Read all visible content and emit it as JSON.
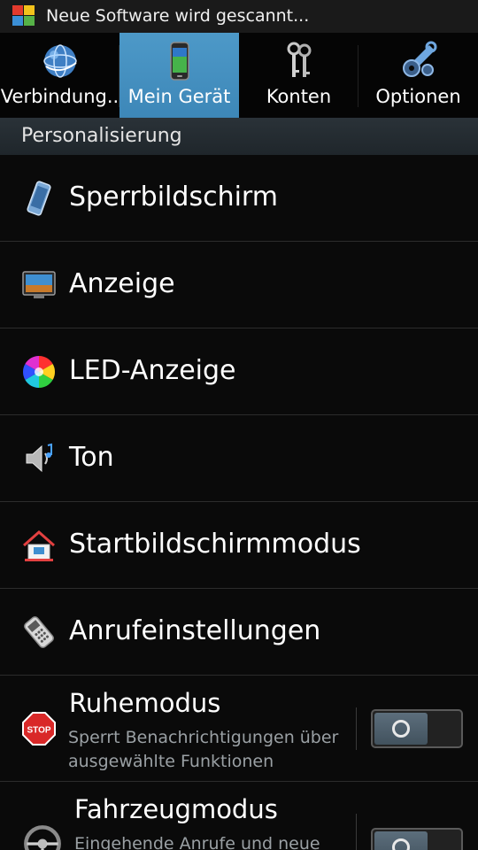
{
  "status_bar": {
    "notification_text": "Neue Software wird gescannt...",
    "icon": "shield-app-icon"
  },
  "tabs": [
    {
      "label": "Verbindung..",
      "icon": "globe-icon",
      "active": false
    },
    {
      "label": "Mein Gerät",
      "icon": "phone-icon",
      "active": true
    },
    {
      "label": "Konten",
      "icon": "keys-icon",
      "active": false
    },
    {
      "label": "Optionen",
      "icon": "wrench-gear-icon",
      "active": false
    }
  ],
  "section": {
    "title": "Personalisierung"
  },
  "items": [
    {
      "label": "Sperrbildschirm",
      "icon": "lock-screen-icon"
    },
    {
      "label": "Anzeige",
      "icon": "monitor-icon"
    },
    {
      "label": "LED-Anzeige",
      "icon": "color-wheel-icon"
    },
    {
      "label": "Ton",
      "icon": "speaker-icon"
    },
    {
      "label": "Startbildschirmmodus",
      "icon": "home-icon"
    },
    {
      "label": "Anrufeinstellungen",
      "icon": "phone-keypad-icon"
    },
    {
      "label": "Ruhemodus",
      "sublabel": "Sperrt Benachrichtigungen über ausgewählte Funktionen",
      "icon": "stop-sign-icon",
      "toggle": "off"
    },
    {
      "label": "Fahrzeugmodus",
      "sublabel": "Eingehende Anrufe und neue",
      "icon": "steering-wheel-icon",
      "toggle": "off"
    }
  ],
  "colors": {
    "active_tab": "#4a95c5",
    "background": "#0a0a0a",
    "sublabel": "#9aa0a4"
  }
}
